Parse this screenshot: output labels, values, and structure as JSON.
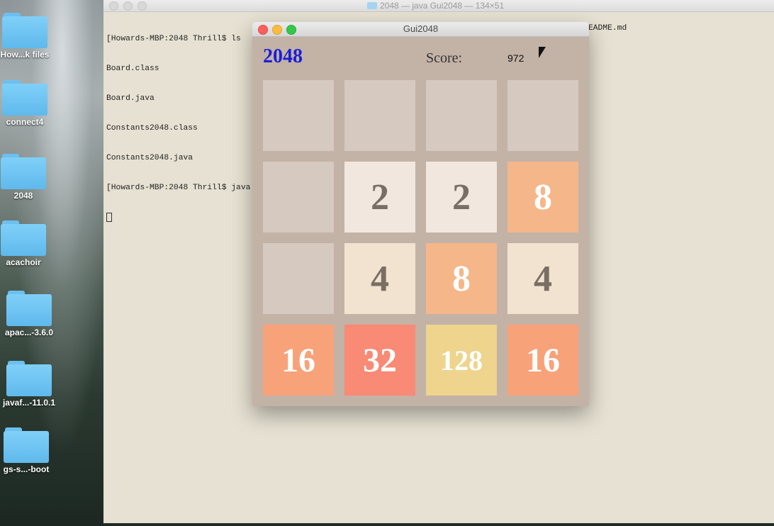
{
  "desktop": {
    "icons": [
      {
        "label": "How...k files"
      },
      {
        "label": "connect4"
      },
      {
        "label": "2048"
      },
      {
        "label": "acachoir"
      },
      {
        "label": "apac...-3.6.0"
      },
      {
        "label": "javaf...-11.0.1"
      },
      {
        "label": "gs-s...-boot"
      }
    ]
  },
  "terminal": {
    "title": "2048 — java Gui2048 — 134×51",
    "lines": [
      "[Howards-MBP:2048 Thrill$ ls",
      "Board.class",
      "Board.java",
      "Constants2048.class",
      "Constants2048.java",
      "[Howards-MBP:2048 Thrill$ java"
    ],
    "right_text": "EADME.md"
  },
  "gui": {
    "window_title": "Gui2048",
    "game_title": "2048",
    "score_label": "Score:",
    "score_value": "972",
    "tiles": [
      [
        {
          "v": "",
          "bg": "#d6c9bf"
        },
        {
          "v": "",
          "bg": "#d6c9bf"
        },
        {
          "v": "",
          "bg": "#d6c9bf"
        },
        {
          "v": "",
          "bg": "#d6c9bf"
        }
      ],
      [
        {
          "v": "",
          "bg": "#d6c9bf"
        },
        {
          "v": "2",
          "bg": "#f1e7df",
          "fg": "#7a6e64"
        },
        {
          "v": "2",
          "bg": "#f1e7df",
          "fg": "#7a6e64"
        },
        {
          "v": "8",
          "bg": "#f5b789",
          "fg": "#ffffff"
        }
      ],
      [
        {
          "v": "",
          "bg": "#d6c9bf"
        },
        {
          "v": "4",
          "bg": "#f1e3cf",
          "fg": "#7a6e64"
        },
        {
          "v": "8",
          "bg": "#f5b789",
          "fg": "#ffffff"
        },
        {
          "v": "4",
          "bg": "#f1e3cf",
          "fg": "#7a6e64"
        }
      ],
      [
        {
          "v": "16",
          "bg": "#f8a27a",
          "fg": "#ffffff"
        },
        {
          "v": "32",
          "bg": "#f98a75",
          "fg": "#ffffff"
        },
        {
          "v": "128",
          "bg": "#eed48d",
          "fg": "#ffffff"
        },
        {
          "v": "16",
          "bg": "#f8a27a",
          "fg": "#ffffff"
        }
      ]
    ]
  }
}
